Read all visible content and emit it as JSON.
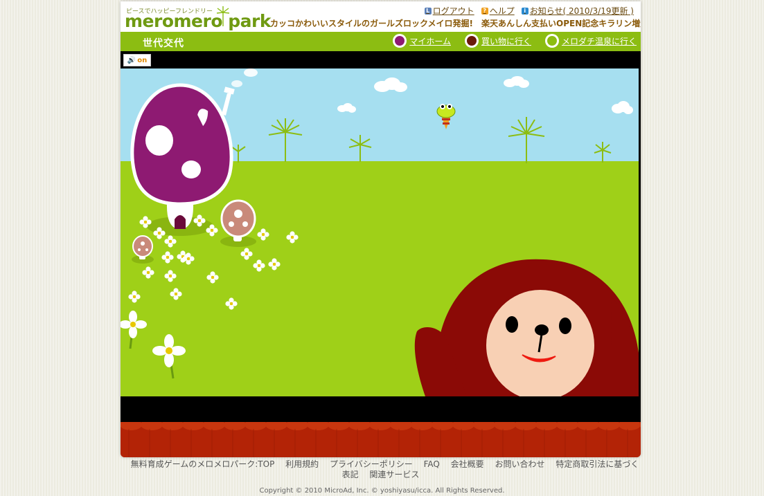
{
  "header": {
    "tagline": "ピースでハッピーフレンドリー",
    "logo": "meromero park",
    "campaign": "カッコかわいいスタイルのガールズロックメイロ発掘!　楽天あんしん支払いOPEN記念キラリン増量中!",
    "nav": [
      {
        "label": "ログアウト",
        "icon": "logout-icon",
        "color": "#5a7fb8"
      },
      {
        "label": "ヘルプ",
        "icon": "help-icon",
        "color": "#f0a020"
      },
      {
        "label": "お知らせ( 2010/3/19更新 )",
        "icon": "info-icon",
        "color": "#2a8ad0"
      }
    ]
  },
  "greenbar": {
    "title": "世代交代",
    "links": [
      {
        "label": "マイホーム",
        "icon": "myhome-icon",
        "color": "#8e1a72"
      },
      {
        "label": "買い物に行く",
        "icon": "shopping-icon",
        "color": "#6a1a0a"
      },
      {
        "label": "メロダチ温泉に行く",
        "icon": "onsen-icon",
        "color": "#8cbd12"
      }
    ],
    "bar_color": "#8cbd12"
  },
  "game": {
    "sound_label": "on",
    "colors": {
      "sky": "#a6dff0",
      "grass": "#9fd018",
      "mushroom": "#8e1a72",
      "small_mushroom": "#c98a7a",
      "character": "#8b0a06",
      "face": "#f8d0b4",
      "curtain": "#b32306"
    }
  },
  "footer": {
    "links": [
      "無料育成ゲームのメロメロパーク:TOP",
      "利用規約",
      "プライバシーポリシー",
      "FAQ",
      "会社概要",
      "お問い合わせ",
      "特定商取引法に基づく表記",
      "関連サービス"
    ],
    "copyright": "Copyright © 2010 MicroAd, Inc. © yoshiyasu/icca. All Rights Reserved."
  }
}
